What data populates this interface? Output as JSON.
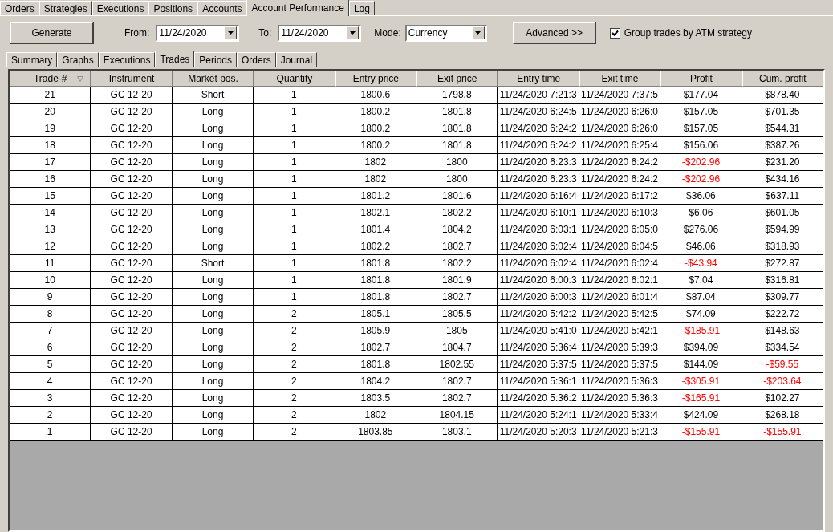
{
  "main_tabs": [
    {
      "label": "Orders",
      "selected": false
    },
    {
      "label": "Strategies",
      "selected": false
    },
    {
      "label": "Executions",
      "selected": false
    },
    {
      "label": "Positions",
      "selected": false
    },
    {
      "label": "Accounts",
      "selected": false
    },
    {
      "label": "Account Performance",
      "selected": true
    },
    {
      "label": "Log",
      "selected": false
    }
  ],
  "toolbar": {
    "generate_button": "Generate",
    "from_label": "From:",
    "from_value": "11/24/2020",
    "to_label": "To:",
    "to_value": "11/24/2020",
    "mode_label": "Mode:",
    "mode_value": "Currency",
    "advanced_button": "Advanced >>",
    "group_checkbox": {
      "label": "Group trades by ATM strategy",
      "checked": true
    }
  },
  "sub_tabs": [
    {
      "label": "Summary",
      "selected": false
    },
    {
      "label": "Graphs",
      "selected": false
    },
    {
      "label": "Executions",
      "selected": false
    },
    {
      "label": "Trades",
      "selected": true
    },
    {
      "label": "Periods",
      "selected": false
    },
    {
      "label": "Orders",
      "selected": false
    },
    {
      "label": "Journal",
      "selected": false
    }
  ],
  "table": {
    "columns": [
      {
        "label": "Trade-#",
        "sorted": true
      },
      {
        "label": "Instrument",
        "sorted": false
      },
      {
        "label": "Market pos.",
        "sorted": false
      },
      {
        "label": "Quantity",
        "sorted": false
      },
      {
        "label": "Entry price",
        "sorted": false
      },
      {
        "label": "Exit price",
        "sorted": false
      },
      {
        "label": "Entry time",
        "sorted": false
      },
      {
        "label": "Exit time",
        "sorted": false
      },
      {
        "label": "Profit",
        "sorted": false
      },
      {
        "label": "Cum. profit",
        "sorted": false
      }
    ],
    "rows": [
      {
        "cells": [
          "21",
          "GC 12-20",
          "Short",
          "1",
          "1800.6",
          "1798.8",
          "11/24/2020 7:21:3",
          "11/24/2020 7:37:5"
        ],
        "profit": "$177.04",
        "profit_negative": false,
        "cum_profit": "$878.40",
        "cum_profit_negative": false
      },
      {
        "cells": [
          "20",
          "GC 12-20",
          "Long",
          "1",
          "1800.2",
          "1801.8",
          "11/24/2020 6:24:5",
          "11/24/2020 6:26:0"
        ],
        "profit": "$157.05",
        "profit_negative": false,
        "cum_profit": "$701.35",
        "cum_profit_negative": false
      },
      {
        "cells": [
          "19",
          "GC 12-20",
          "Long",
          "1",
          "1800.2",
          "1801.8",
          "11/24/2020 6:24:2",
          "11/24/2020 6:26:0"
        ],
        "profit": "$157.05",
        "profit_negative": false,
        "cum_profit": "$544.31",
        "cum_profit_negative": false
      },
      {
        "cells": [
          "18",
          "GC 12-20",
          "Long",
          "1",
          "1800.2",
          "1801.8",
          "11/24/2020 6:24:2",
          "11/24/2020 6:25:4"
        ],
        "profit": "$156.06",
        "profit_negative": false,
        "cum_profit": "$387.26",
        "cum_profit_negative": false
      },
      {
        "cells": [
          "17",
          "GC 12-20",
          "Long",
          "1",
          "1802",
          "1800",
          "11/24/2020 6:23:3",
          "11/24/2020 6:24:2"
        ],
        "profit": "-$202.96",
        "profit_negative": true,
        "cum_profit": "$231.20",
        "cum_profit_negative": false
      },
      {
        "cells": [
          "16",
          "GC 12-20",
          "Long",
          "1",
          "1802",
          "1800",
          "11/24/2020 6:23:3",
          "11/24/2020 6:24:2"
        ],
        "profit": "-$202.96",
        "profit_negative": true,
        "cum_profit": "$434.16",
        "cum_profit_negative": false
      },
      {
        "cells": [
          "15",
          "GC 12-20",
          "Long",
          "1",
          "1801.2",
          "1801.6",
          "11/24/2020 6:16:4",
          "11/24/2020 6:17:2"
        ],
        "profit": "$36.06",
        "profit_negative": false,
        "cum_profit": "$637.11",
        "cum_profit_negative": false
      },
      {
        "cells": [
          "14",
          "GC 12-20",
          "Long",
          "1",
          "1802.1",
          "1802.2",
          "11/24/2020 6:10:1",
          "11/24/2020 6:10:3"
        ],
        "profit": "$6.06",
        "profit_negative": false,
        "cum_profit": "$601.05",
        "cum_profit_negative": false
      },
      {
        "cells": [
          "13",
          "GC 12-20",
          "Long",
          "1",
          "1801.4",
          "1804.2",
          "11/24/2020 6:03:1",
          "11/24/2020 6:05:0"
        ],
        "profit": "$276.06",
        "profit_negative": false,
        "cum_profit": "$594.99",
        "cum_profit_negative": false
      },
      {
        "cells": [
          "12",
          "GC 12-20",
          "Long",
          "1",
          "1802.2",
          "1802.7",
          "11/24/2020 6:02:4",
          "11/24/2020 6:04:5"
        ],
        "profit": "$46.06",
        "profit_negative": false,
        "cum_profit": "$318.93",
        "cum_profit_negative": false
      },
      {
        "cells": [
          "11",
          "GC 12-20",
          "Short",
          "1",
          "1801.8",
          "1802.2",
          "11/24/2020 6:02:4",
          "11/24/2020 6:02:4"
        ],
        "profit": "-$43.94",
        "profit_negative": true,
        "cum_profit": "$272.87",
        "cum_profit_negative": false
      },
      {
        "cells": [
          "10",
          "GC 12-20",
          "Long",
          "1",
          "1801.8",
          "1801.9",
          "11/24/2020 6:00:3",
          "11/24/2020 6:02:1"
        ],
        "profit": "$7.04",
        "profit_negative": false,
        "cum_profit": "$316.81",
        "cum_profit_negative": false
      },
      {
        "cells": [
          "9",
          "GC 12-20",
          "Long",
          "1",
          "1801.8",
          "1802.7",
          "11/24/2020 6:00:3",
          "11/24/2020 6:01:4"
        ],
        "profit": "$87.04",
        "profit_negative": false,
        "cum_profit": "$309.77",
        "cum_profit_negative": false
      },
      {
        "cells": [
          "8",
          "GC 12-20",
          "Long",
          "2",
          "1805.1",
          "1805.5",
          "11/24/2020 5:42:2",
          "11/24/2020 5:42:5"
        ],
        "profit": "$74.09",
        "profit_negative": false,
        "cum_profit": "$222.72",
        "cum_profit_negative": false
      },
      {
        "cells": [
          "7",
          "GC 12-20",
          "Long",
          "2",
          "1805.9",
          "1805",
          "11/24/2020 5:41:0",
          "11/24/2020 5:42:1"
        ],
        "profit": "-$185.91",
        "profit_negative": true,
        "cum_profit": "$148.63",
        "cum_profit_negative": false
      },
      {
        "cells": [
          "6",
          "GC 12-20",
          "Long",
          "2",
          "1802.7",
          "1804.7",
          "11/24/2020 5:36:4",
          "11/24/2020 5:39:3"
        ],
        "profit": "$394.09",
        "profit_negative": false,
        "cum_profit": "$334.54",
        "cum_profit_negative": false
      },
      {
        "cells": [
          "5",
          "GC 12-20",
          "Long",
          "2",
          "1801.8",
          "1802.55",
          "11/24/2020 5:37:5",
          "11/24/2020 5:37:5"
        ],
        "profit": "$144.09",
        "profit_negative": false,
        "cum_profit": "-$59.55",
        "cum_profit_negative": true
      },
      {
        "cells": [
          "4",
          "GC 12-20",
          "Long",
          "2",
          "1804.2",
          "1802.7",
          "11/24/2020 5:36:1",
          "11/24/2020 5:36:3"
        ],
        "profit": "-$305.91",
        "profit_negative": true,
        "cum_profit": "-$203.64",
        "cum_profit_negative": true
      },
      {
        "cells": [
          "3",
          "GC 12-20",
          "Long",
          "2",
          "1803.5",
          "1802.7",
          "11/24/2020 5:36:2",
          "11/24/2020 5:36:3"
        ],
        "profit": "-$165.91",
        "profit_negative": true,
        "cum_profit": "$102.27",
        "cum_profit_negative": false
      },
      {
        "cells": [
          "2",
          "GC 12-20",
          "Long",
          "2",
          "1802",
          "1804.15",
          "11/24/2020 5:24:1",
          "11/24/2020 5:33:4"
        ],
        "profit": "$424.09",
        "profit_negative": false,
        "cum_profit": "$268.18",
        "cum_profit_negative": false
      },
      {
        "cells": [
          "1",
          "GC 12-20",
          "Long",
          "2",
          "1803.85",
          "1803.1",
          "11/24/2020 5:20:3",
          "11/24/2020 5:21:3"
        ],
        "profit": "-$155.91",
        "profit_negative": true,
        "cum_profit": "-$155.91",
        "cum_profit_negative": true
      }
    ]
  }
}
